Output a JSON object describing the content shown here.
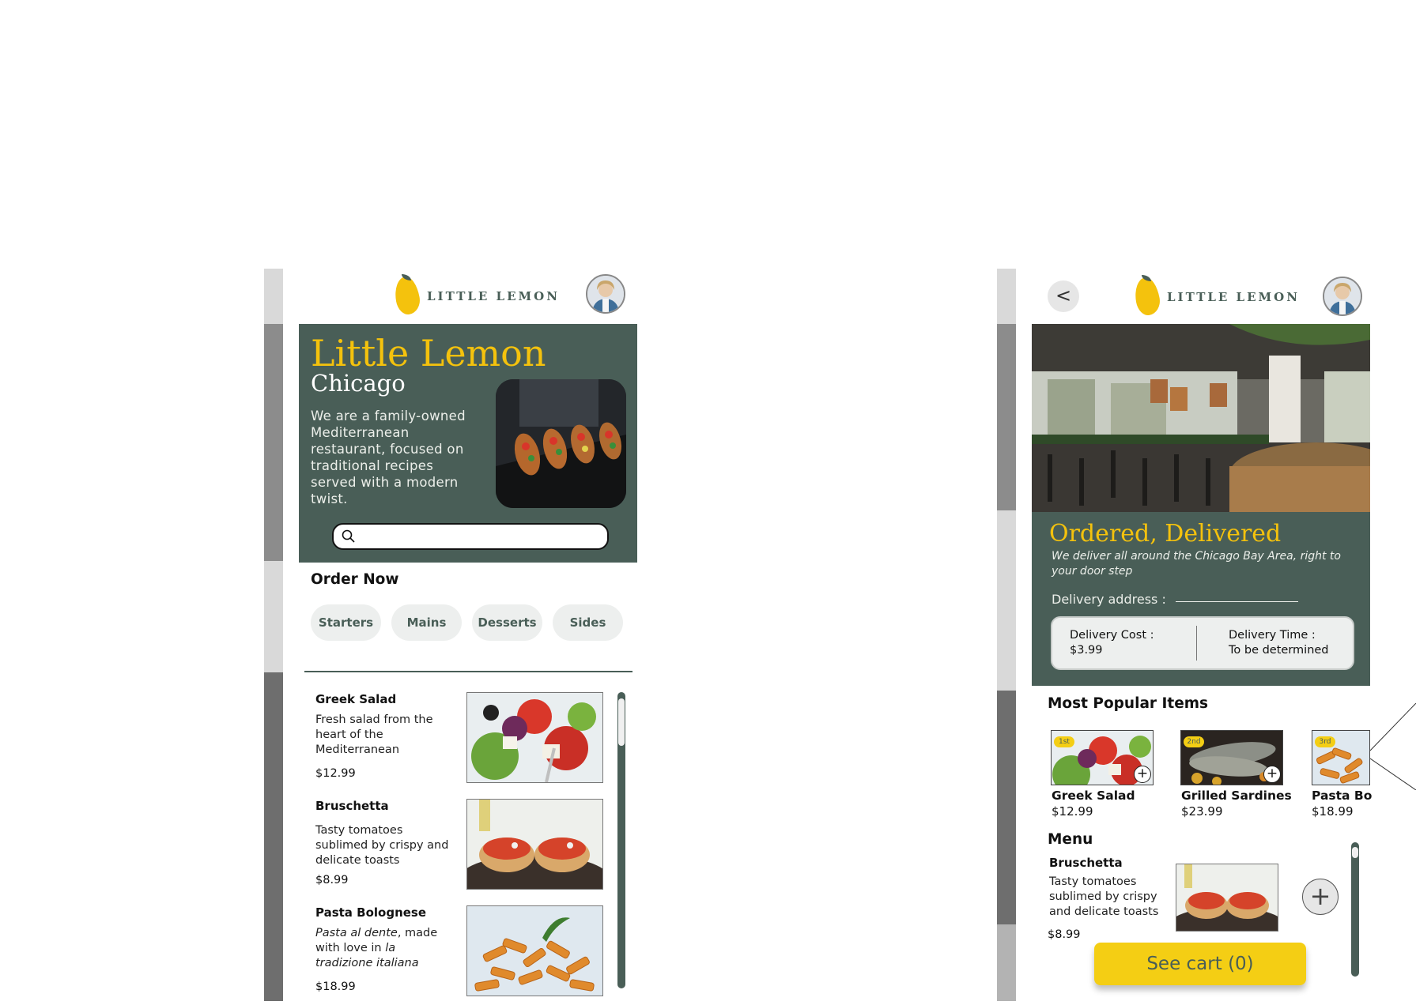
{
  "left": {
    "logo_text": "LITTLE LEMON",
    "hero": {
      "title": "Little Lemon",
      "subtitle": "Chicago",
      "description": "We are a family-owned Mediterranean restaurant, focused on traditional recipes served with a modern twist."
    },
    "order_now": "Order Now",
    "categories": [
      "Starters",
      "Mains",
      "Desserts",
      "Sides"
    ],
    "items": [
      {
        "title": "Greek Salad",
        "desc": "Fresh salad from the heart of the Mediterranean",
        "price": "$12.99"
      },
      {
        "title": "Bruschetta",
        "desc": "Tasty tomatoes sublimed by crispy and delicate toasts",
        "price": "$8.99"
      },
      {
        "title": "Pasta Bolognese",
        "desc_italic1": "Pasta al dente",
        "desc_plain": ", made with love in ",
        "desc_italic2": "la tradizione italiana",
        "price": "$18.99"
      }
    ]
  },
  "right": {
    "back_icon": "chevron-left-icon",
    "back_label": "<",
    "logo_text": "LITTLE LEMON",
    "hero": {
      "title": "Ordered, Delivered",
      "subtitle": "We deliver all around the Chicago Bay Area, right to your door step",
      "address_label": "Delivery address :",
      "address_value": "",
      "cost_label": "Delivery Cost :",
      "cost_value": "$3.99",
      "time_label": "Delivery Time :",
      "time_value": "To be determined"
    },
    "popular_title": "Most Popular Items",
    "popular": [
      {
        "rank": "1st",
        "name": "Greek Salad",
        "price": "$12.99"
      },
      {
        "rank": "2nd",
        "name": "Grilled Sardines",
        "price": "$23.99"
      },
      {
        "rank": "3rd",
        "name": "Pasta Bol",
        "price": "$18.99"
      }
    ],
    "menu_title": "Menu",
    "menu_item": {
      "title": "Bruschetta",
      "desc": "Tasty tomatoes sublimed by crispy and delicate toasts",
      "price": "$8.99"
    },
    "cart_label": "See cart (0)"
  },
  "colors": {
    "brand_green": "#495e57",
    "brand_yellow": "#f4ce14",
    "pill_bg": "#edefee"
  }
}
